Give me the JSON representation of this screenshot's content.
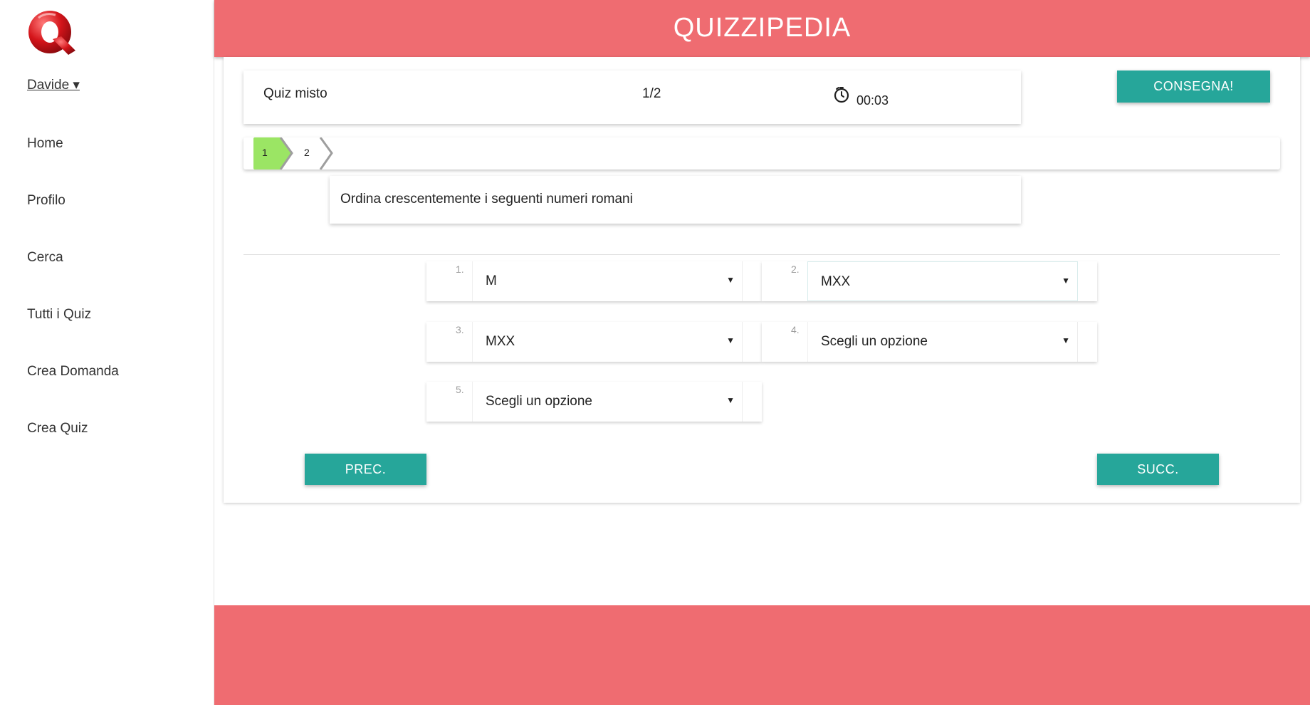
{
  "app": {
    "title": "QUIZZIPEDIA",
    "brand_color": "#ef6c71",
    "accent_color": "#26a69a"
  },
  "sidebar": {
    "user": "Davide ▾",
    "items": [
      {
        "label": "Home"
      },
      {
        "label": "Profilo"
      },
      {
        "label": "Cerca"
      },
      {
        "label": "Tutti i Quiz"
      },
      {
        "label": "Crea Domanda"
      },
      {
        "label": "Crea Quiz"
      }
    ]
  },
  "quiz": {
    "name": "Quiz misto",
    "progress": "1/2",
    "timer": "00:03",
    "submit_label": "CONSEGNA!"
  },
  "steps": [
    {
      "label": "1",
      "status": "current",
      "color": "#9be564"
    },
    {
      "label": "2",
      "status": "pending"
    }
  ],
  "question": {
    "text": "Ordina crescentemente i seguenti numeri romani"
  },
  "answers": [
    {
      "num": "1.",
      "value": "M"
    },
    {
      "num": "2.",
      "value": "MXX"
    },
    {
      "num": "3.",
      "value": "MXX"
    },
    {
      "num": "4.",
      "value": "Scegli un opzione"
    },
    {
      "num": "5.",
      "value": "Scegli un opzione"
    }
  ],
  "nav": {
    "prev_label": "PREC.",
    "next_label": "SUCC."
  }
}
